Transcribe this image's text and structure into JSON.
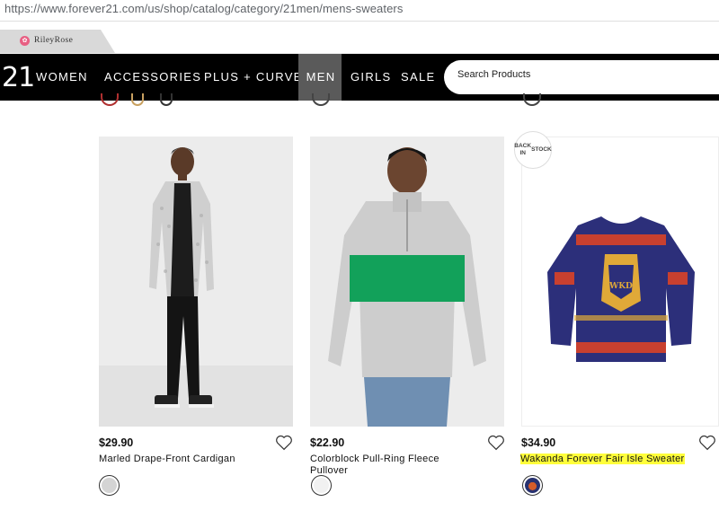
{
  "browser": {
    "url": "https://www.forever21.com/us/shop/catalog/category/21men/mens-sweaters"
  },
  "tab": {
    "brand": "RileyRose"
  },
  "nav": {
    "logo": "21",
    "items": [
      "WOMEN",
      "ACCESSORIES",
      "PLUS + CURVE",
      "MEN",
      "GIRLS",
      "SALE"
    ],
    "active": "MEN",
    "search_placeholder": "Search Products"
  },
  "products": [
    {
      "price": "$29.90",
      "name": "Marled Drape-Front Cardigan",
      "swatch_color": "#d4d4d4"
    },
    {
      "price": "$22.90",
      "name": "Colorblock Pull-Ring Fleece Pullover",
      "swatch_color": "#f1f1f1"
    },
    {
      "price": "$34.90",
      "name": "Wakanda Forever Fair Isle Sweater",
      "swatch_color": "#283270",
      "badge": "BACK IN STOCK"
    }
  ],
  "colors": {
    "nav_bg": "#000000",
    "nav_active": "#5a5a5a",
    "highlight": "#fffe3a",
    "rr_pink": "#e85f83"
  }
}
